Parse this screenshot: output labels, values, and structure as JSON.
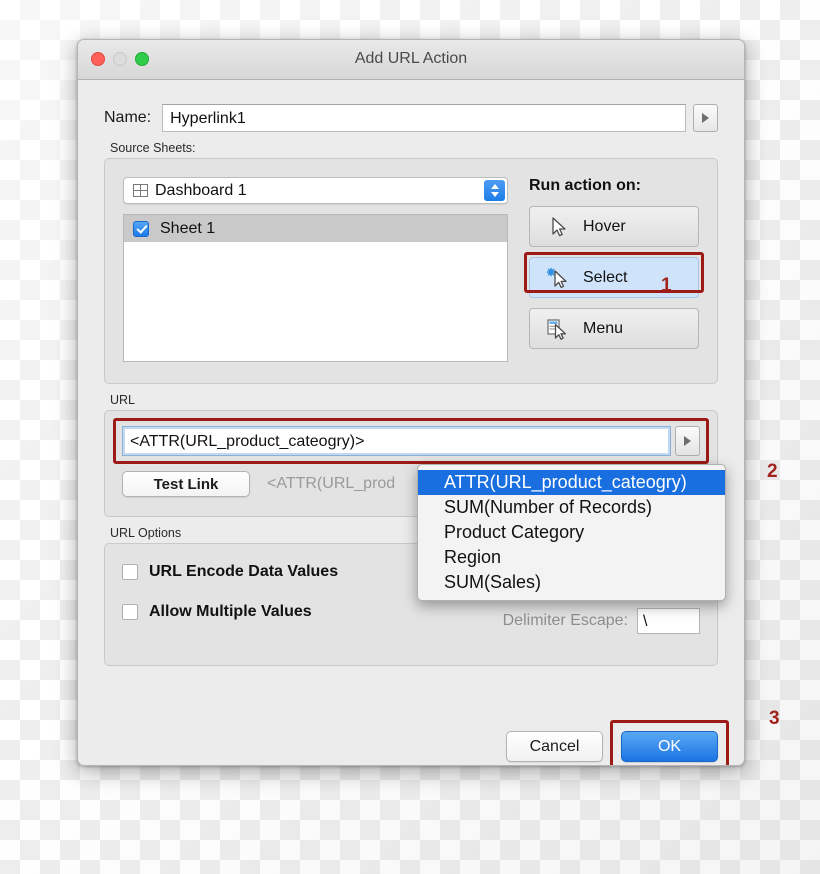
{
  "window": {
    "title": "Add URL Action",
    "traffic_lights": [
      "close-red",
      "minimize-gray",
      "zoom-green"
    ]
  },
  "name_field": {
    "label": "Name:",
    "value": "Hyperlink1",
    "placeholder": "",
    "arrow_button_icon": "play-triangle-icon"
  },
  "source_sheets": {
    "group_label": "Source Sheets:",
    "dropdown": {
      "icon": "dashboard-grid-icon",
      "value": "Dashboard 1",
      "options": [
        "Dashboard 1"
      ]
    },
    "sheet_list": [
      {
        "label": "Sheet 1",
        "checked": true,
        "selected": true
      }
    ]
  },
  "run_action_on": {
    "title": "Run action on:",
    "buttons": [
      {
        "label": "Hover",
        "icon": "cursor-arrow-icon",
        "selected": false
      },
      {
        "label": "Select",
        "icon": "cursor-arrow-sparkle-icon",
        "selected": true
      },
      {
        "label": "Menu",
        "icon": "cursor-arrow-menu-icon",
        "selected": false
      }
    ]
  },
  "url_section": {
    "group_label": "URL",
    "value": "<ATTR(URL_product_cateogry)>",
    "arrow_button_icon": "play-triangle-icon",
    "test_link_label": "Test Link",
    "preview_text": "<ATTR(URL_prod"
  },
  "field_dropdown": {
    "items": [
      {
        "label": "ATTR(URL_product_cateogry)",
        "selected": true
      },
      {
        "label": "SUM(Number of Records)",
        "selected": false
      },
      {
        "label": "Product Category",
        "selected": false
      },
      {
        "label": "Region",
        "selected": false
      },
      {
        "label": "SUM(Sales)",
        "selected": false
      }
    ]
  },
  "url_options": {
    "group_label": "URL Options",
    "checkboxes": [
      {
        "label": "URL Encode Data Values",
        "checked": false
      },
      {
        "label": "Allow Multiple Values",
        "checked": false
      }
    ],
    "delimiter_escape": {
      "label": "Delimiter Escape:",
      "value": "\\"
    }
  },
  "footer": {
    "cancel_label": "Cancel",
    "ok_label": "OK"
  },
  "annotations": [
    {
      "id": "1",
      "text": "1"
    },
    {
      "id": "2",
      "text": "2"
    },
    {
      "id": "3",
      "text": "3"
    }
  ],
  "colors": {
    "annotation_red": "#a2231d",
    "highlight_box_red": "#9e1a16",
    "accent_blue": "#1b74e4",
    "selected_button_blue": "#cfe4fa",
    "dropdown_highlight": "#1a6fe0"
  }
}
